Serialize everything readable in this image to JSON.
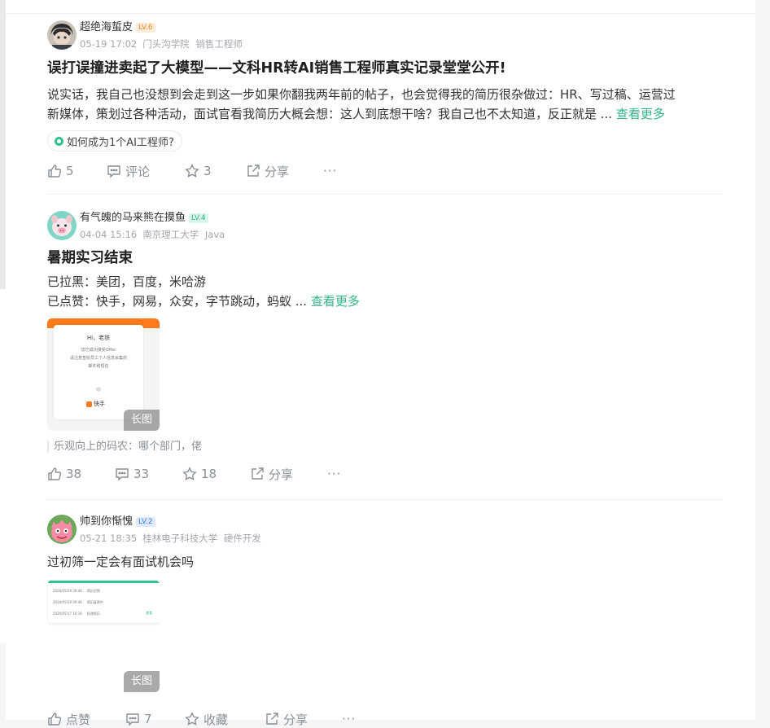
{
  "posts": [
    {
      "author": "超绝海蜇皮",
      "level": "LV.6",
      "level_bg": "#fdecd9",
      "level_fg": "#f08a2c",
      "date": "05-19 17:02",
      "org": "门头沟学院",
      "role": "销售工程师",
      "title": "误打误撞进卖起了大模型——文科HR转AI销售工程师真实记录堂堂公开!",
      "body_line1": "说实话，我自己也没想到会走到这一步如果你翻我两年前的帖子，也会觉得我的简历很杂做过：HR、写过稿、运营过",
      "body_line2": "新媒体，策划过各种活动，面试官看我简历大概会想：这人到底想干啥？我自己也不太知道，反正就是 ...",
      "see_more": "查看更多",
      "topic": "如何成为1个AI工程师?",
      "likes": "5",
      "comments": "评论",
      "stars": "3",
      "share": "分享",
      "more": "···"
    },
    {
      "author": "有气魄的马来熊在摸鱼",
      "level": "LV.4",
      "level_bg": "#dcf5ec",
      "level_fg": "#2fb487",
      "date": "04-04 15:16",
      "org": "南京理工大学",
      "role": "Java",
      "title": "暑期实习结束",
      "body_line1": "已拉黑：美团，百度，米哈游",
      "body_line2": "已点赞：快手，网易，众安，字节跳动，蚂蚁 ...",
      "see_more": "查看更多",
      "image_badge": "长图",
      "image_text": {
        "greeting": "Hi，老铁",
        "line1": "您已成功接受Offer",
        "line2": "请注意查收员工个人信息采集的",
        "line3": "邮件和短信",
        "brand": "快手"
      },
      "comment_preview": "乐观向上的码农：哪个部门，佬",
      "likes": "38",
      "comments": "33",
      "stars": "18",
      "share": "分享",
      "more": "···"
    },
    {
      "author": "帅到你惭愧",
      "level": "LV.2",
      "level_bg": "#dde9fb",
      "level_fg": "#3d7fe0",
      "date": "05-21 18:35",
      "org": "桂林电子科技大学",
      "role": "硬件开发",
      "title": "过初筛一定会有面试机会吗",
      "image_badge": "长图",
      "timeline": [
        {
          "time": "2026/05/19 09:46",
          "status": "简历初筛"
        },
        {
          "time": "2026/05/19 09:46",
          "status": "简历复筛中"
        },
        {
          "time": "2026/05/17 16:16",
          "status": "投递简历"
        }
      ],
      "timeline_tag": "查看",
      "likes": "点赞",
      "comments": "7",
      "stars": "收藏",
      "share": "分享",
      "more": "···"
    }
  ],
  "colors": {
    "accent": "#32b489",
    "meta": "#a3a7ad",
    "action": "#8a8f96",
    "kuaishou": "#ff7a1a"
  }
}
